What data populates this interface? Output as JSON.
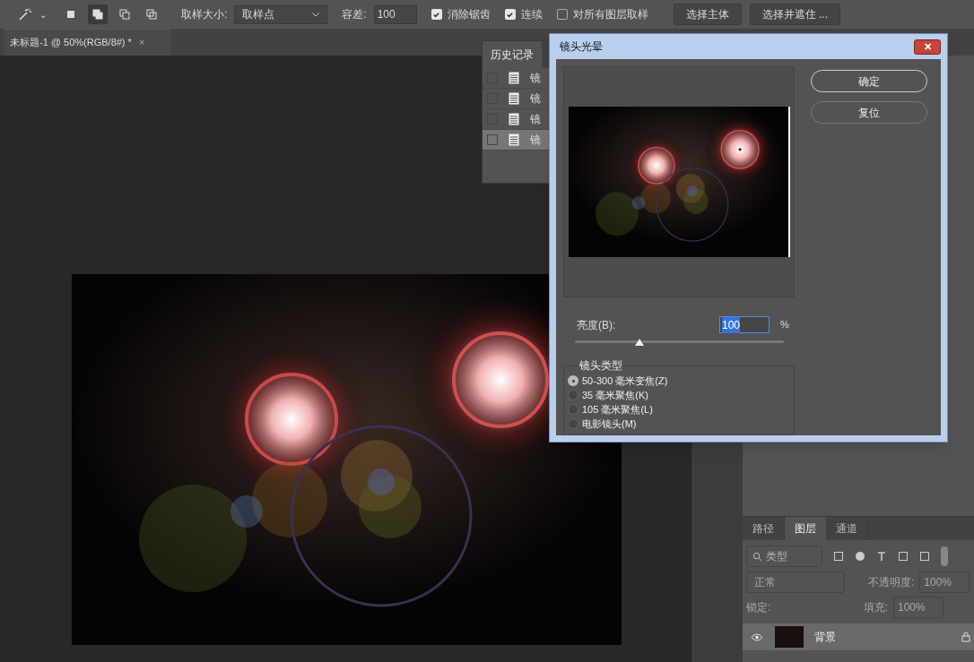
{
  "options_bar": {
    "tool_caret": "⌄",
    "selection_modes": [
      {
        "selected": false
      },
      {
        "selected": true
      },
      {
        "selected": false
      },
      {
        "selected": false
      }
    ],
    "sample_size_label": "取样大小:",
    "sample_size_value": "取样点",
    "tolerance_label": "容差:",
    "tolerance_value": "100",
    "checkboxes": [
      {
        "label": "消除锯齿",
        "checked": true
      },
      {
        "label": "连续",
        "checked": true
      },
      {
        "label": "对所有图层取样",
        "checked": false
      }
    ],
    "buttons": [
      "选择主体",
      "选择并遮住 ..."
    ]
  },
  "document_tab": {
    "title": "未标题-1 @ 50%(RGB/8#) *",
    "close": "×"
  },
  "history_panel": {
    "tab": "历史记录",
    "items": [
      {
        "label": "镜",
        "selected": false
      },
      {
        "label": "镜",
        "selected": false
      },
      {
        "label": "镜",
        "selected": false
      },
      {
        "label": "镜",
        "selected": true
      }
    ]
  },
  "dialog": {
    "title": "镜头光晕",
    "close": "✕",
    "buttons": [
      "确定",
      "复位"
    ],
    "brightness_label": "亮度(B):",
    "brightness_value": "100",
    "brightness_unit": "%",
    "level": 0.31,
    "lens_type_legend": "镜头类型",
    "lens_types": [
      {
        "label": "50-300 毫米变焦(Z)",
        "selected": true
      },
      {
        "label": "35 毫米聚焦(K)",
        "selected": false
      },
      {
        "label": "105 毫米聚焦(L)",
        "selected": false
      },
      {
        "label": "电影镜头(M)",
        "selected": false
      }
    ]
  },
  "layers_panel": {
    "tabs": [
      {
        "label": "路径",
        "selected": false
      },
      {
        "label": "图层",
        "selected": true
      },
      {
        "label": "通道",
        "selected": false
      }
    ],
    "filter": "类型",
    "blend_mode": "正常",
    "opacity_label": "不透明度:",
    "opacity": "100%",
    "lock_label": "锁定:",
    "fill_label": "填充:",
    "fill": "100%",
    "layers": [
      {
        "name": "背景",
        "visible": true,
        "locked": true
      }
    ]
  }
}
